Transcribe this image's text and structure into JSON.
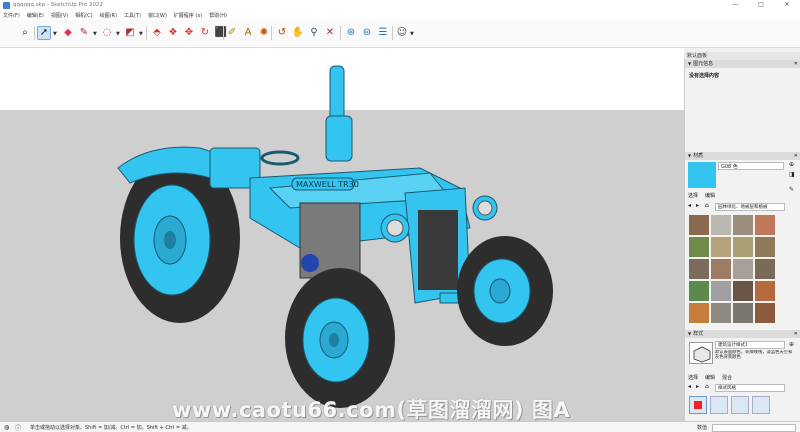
{
  "window": {
    "title": "qqqqqq.skp - SketchUp Pro 2022",
    "controls": [
      "—",
      "□",
      "✕"
    ]
  },
  "menu": [
    "文件(F)",
    "编辑(E)",
    "视图(V)",
    "相机(C)",
    "绘图(R)",
    "工具(T)",
    "窗口(W)",
    "扩展程序 (x)",
    "帮助(H)"
  ],
  "toolbar": {
    "icons": [
      "search-icon",
      "select-icon",
      "eraser-icon",
      "pencil-icon",
      "shape-icon",
      "paint-bucket-icon",
      "push-pull-icon",
      "offset-icon",
      "move-icon",
      "rotate-icon",
      "scale-icon",
      "tape-measure-icon",
      "text-icon",
      "paint-icon",
      "orbit-icon",
      "pan-icon",
      "zoom-icon",
      "zoom-extents-icon",
      "component-icon",
      "warehouse-icon",
      "extension-icon",
      "user-icon"
    ]
  },
  "viewport": {
    "small_watermark": "www.caotu66.com",
    "model_badge": "MAXWELL TR30",
    "model_color": "#33c4f0",
    "sky_color": "#ffffff",
    "ground_color": "#cfcfcf"
  },
  "tray": {
    "title": "默认面板",
    "entity_info": {
      "header": "图元信息",
      "content": "没有选择内容"
    },
    "materials": {
      "header": "材质",
      "current_name": "G08 色",
      "current_color": "#33c4f0",
      "tabs": [
        "选择",
        "编辑"
      ],
      "library": "园林绿化、地被层和植被",
      "swatches": [
        "#8a6a4e",
        "#b8b8b0",
        "#9c8e7c",
        "#c0785a",
        "#6f8a4a",
        "#b3a27a",
        "#a6a072",
        "#8f7a5c",
        "#7c6c5c",
        "#9c7c64",
        "#a8a098",
        "#7a6a58",
        "#5c8a4c",
        "#a0a0a0",
        "#6a5648",
        "#b46a3c",
        "#c67c3a",
        "#8e8a82",
        "#7a7670",
        "#8c5a3c"
      ]
    },
    "styles": {
      "header": "样式",
      "style_name": "建筑设计样式1",
      "description": "默认表面颜色，轮廓线线，淡蓝色天空和灰色背景颜色",
      "tabs": [
        "选择",
        "编辑",
        "混合"
      ],
      "collection": "样式风格"
    }
  },
  "status": {
    "message": "单击或拖动以选择对象。Shift = 加/减。Ctrl = 加。Shift + Ctrl = 减。",
    "measurements_label": "数值"
  },
  "watermark": "www.caotu66.com(草图溜溜网) 图A"
}
